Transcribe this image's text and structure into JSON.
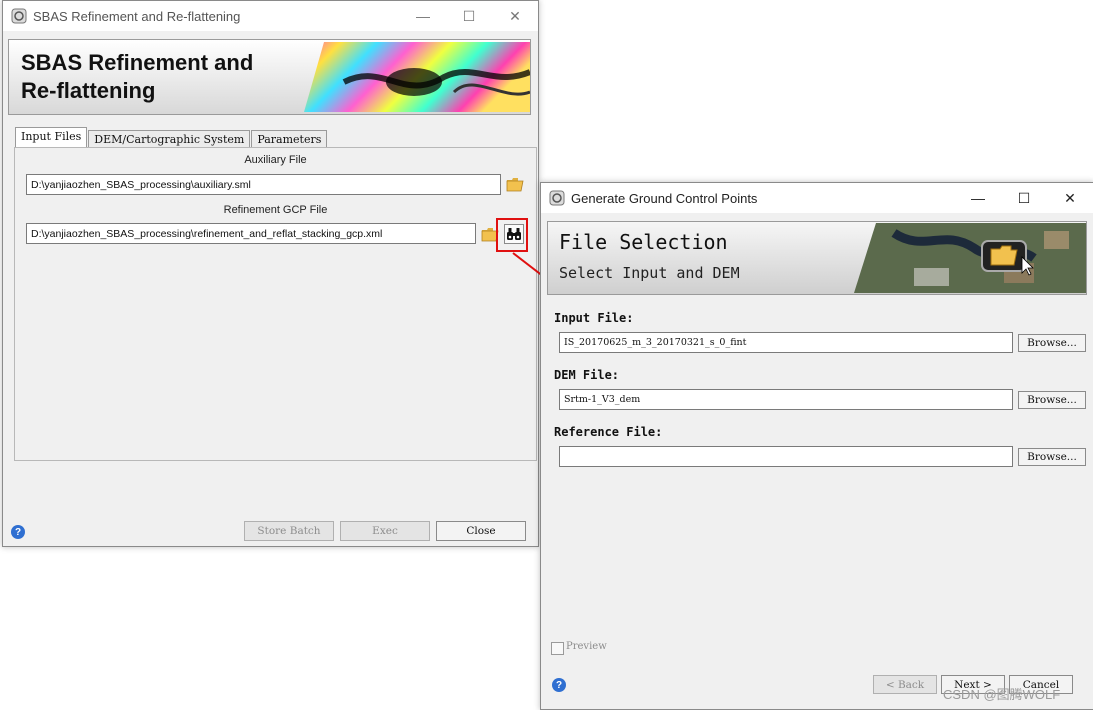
{
  "sbas_window": {
    "title": "SBAS Refinement and Re-flattening",
    "banner_line1": "SBAS Refinement and",
    "banner_line2": "Re-flattening",
    "tabs": [
      {
        "label": "Input Files"
      },
      {
        "label": "DEM/Cartographic System"
      },
      {
        "label": "Parameters"
      }
    ],
    "auxiliary_label": "Auxiliary File",
    "auxiliary_value": "D:\\yanjiaozhen_SBAS_processing\\auxiliary.sml",
    "gcp_label": "Refinement GCP File",
    "gcp_value": "D:\\yanjiaozhen_SBAS_processing\\refinement_and_reflat_stacking_gcp.xml",
    "buttons": {
      "store_batch": "Store Batch",
      "exec": "Exec",
      "close": "Close"
    },
    "help": "?"
  },
  "gcp_window": {
    "title": "Generate Ground Control Points",
    "banner_title": "File Selection",
    "banner_subtitle": "Select Input and DEM",
    "input_label": "Input File:",
    "input_value": "IS_20170625_m_3_20170321_s_0_fint",
    "dem_label": "DEM File:",
    "dem_value": "Srtm-1_V3_dem",
    "reference_label": "Reference File:",
    "reference_value": "",
    "browse": "Browse...",
    "preview": "Preview",
    "back": "< Back",
    "next": "Next >",
    "cancel": "Cancel",
    "help": "?"
  },
  "watermark": "CSDN @图腾WOLF",
  "colors": {
    "annotation_red": "#e01010",
    "help_blue": "#2f6fd1"
  }
}
